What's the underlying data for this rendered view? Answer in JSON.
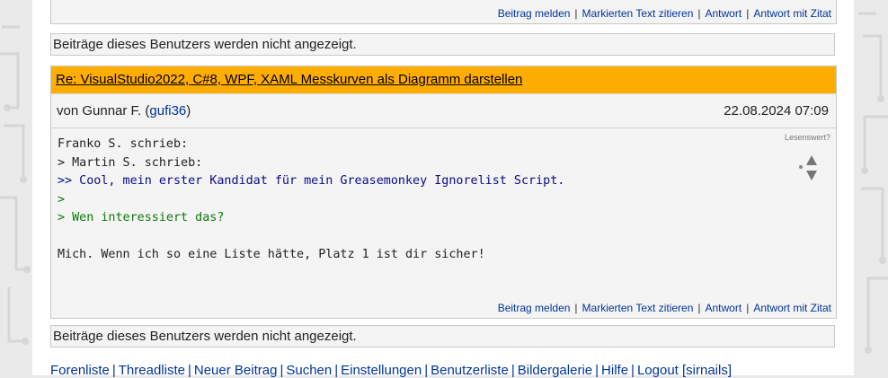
{
  "actions": {
    "report": "Beitrag melden",
    "quote_selected": "Markierten Text zitieren",
    "reply": "Antwort",
    "reply_quote": "Antwort mit Zitat"
  },
  "hidden_notice": "Beiträge dieses Benutzers werden nicht angezeigt.",
  "post": {
    "title": "Re: VisualStudio2022, C#8, WPF, XAML Messkurven als Diagramm darstellen",
    "author_prefix": "von Gunnar F. (",
    "author_username": "gufi36",
    "author_suffix": ")",
    "date": "22.08.2024 07:09",
    "rating_label": "Lesenswert?",
    "lines": [
      {
        "text": "Franko S. schrieb:",
        "level": "q1"
      },
      {
        "text": "> Martin S. schrieb:",
        "level": "q1"
      },
      {
        "text": ">> Cool, mein erster Kandidat für mein Greasemonkey Ignorelist Script.",
        "level": "q2"
      },
      {
        "text": ">",
        "level": "q3"
      },
      {
        "text": "> Wen interessiert das?",
        "level": "q3"
      },
      {
        "text": "",
        "level": "q1"
      },
      {
        "text": "Mich. Wenn ich so eine Liste hätte, Platz 1 ist dir sicher!",
        "level": "q1"
      }
    ]
  },
  "footer": {
    "links": [
      "Forenliste",
      "Threadliste",
      "Neuer Beitrag",
      "Suchen",
      "Einstellungen",
      "Benutzerliste",
      "Bildergalerie",
      "Hilfe",
      "Logout [sirnails]"
    ]
  },
  "colors": {
    "title_bar": "#ffad00",
    "link": "#00349a",
    "quote_level2": "#0a0a86",
    "quote_level3": "#0a7a0a"
  }
}
